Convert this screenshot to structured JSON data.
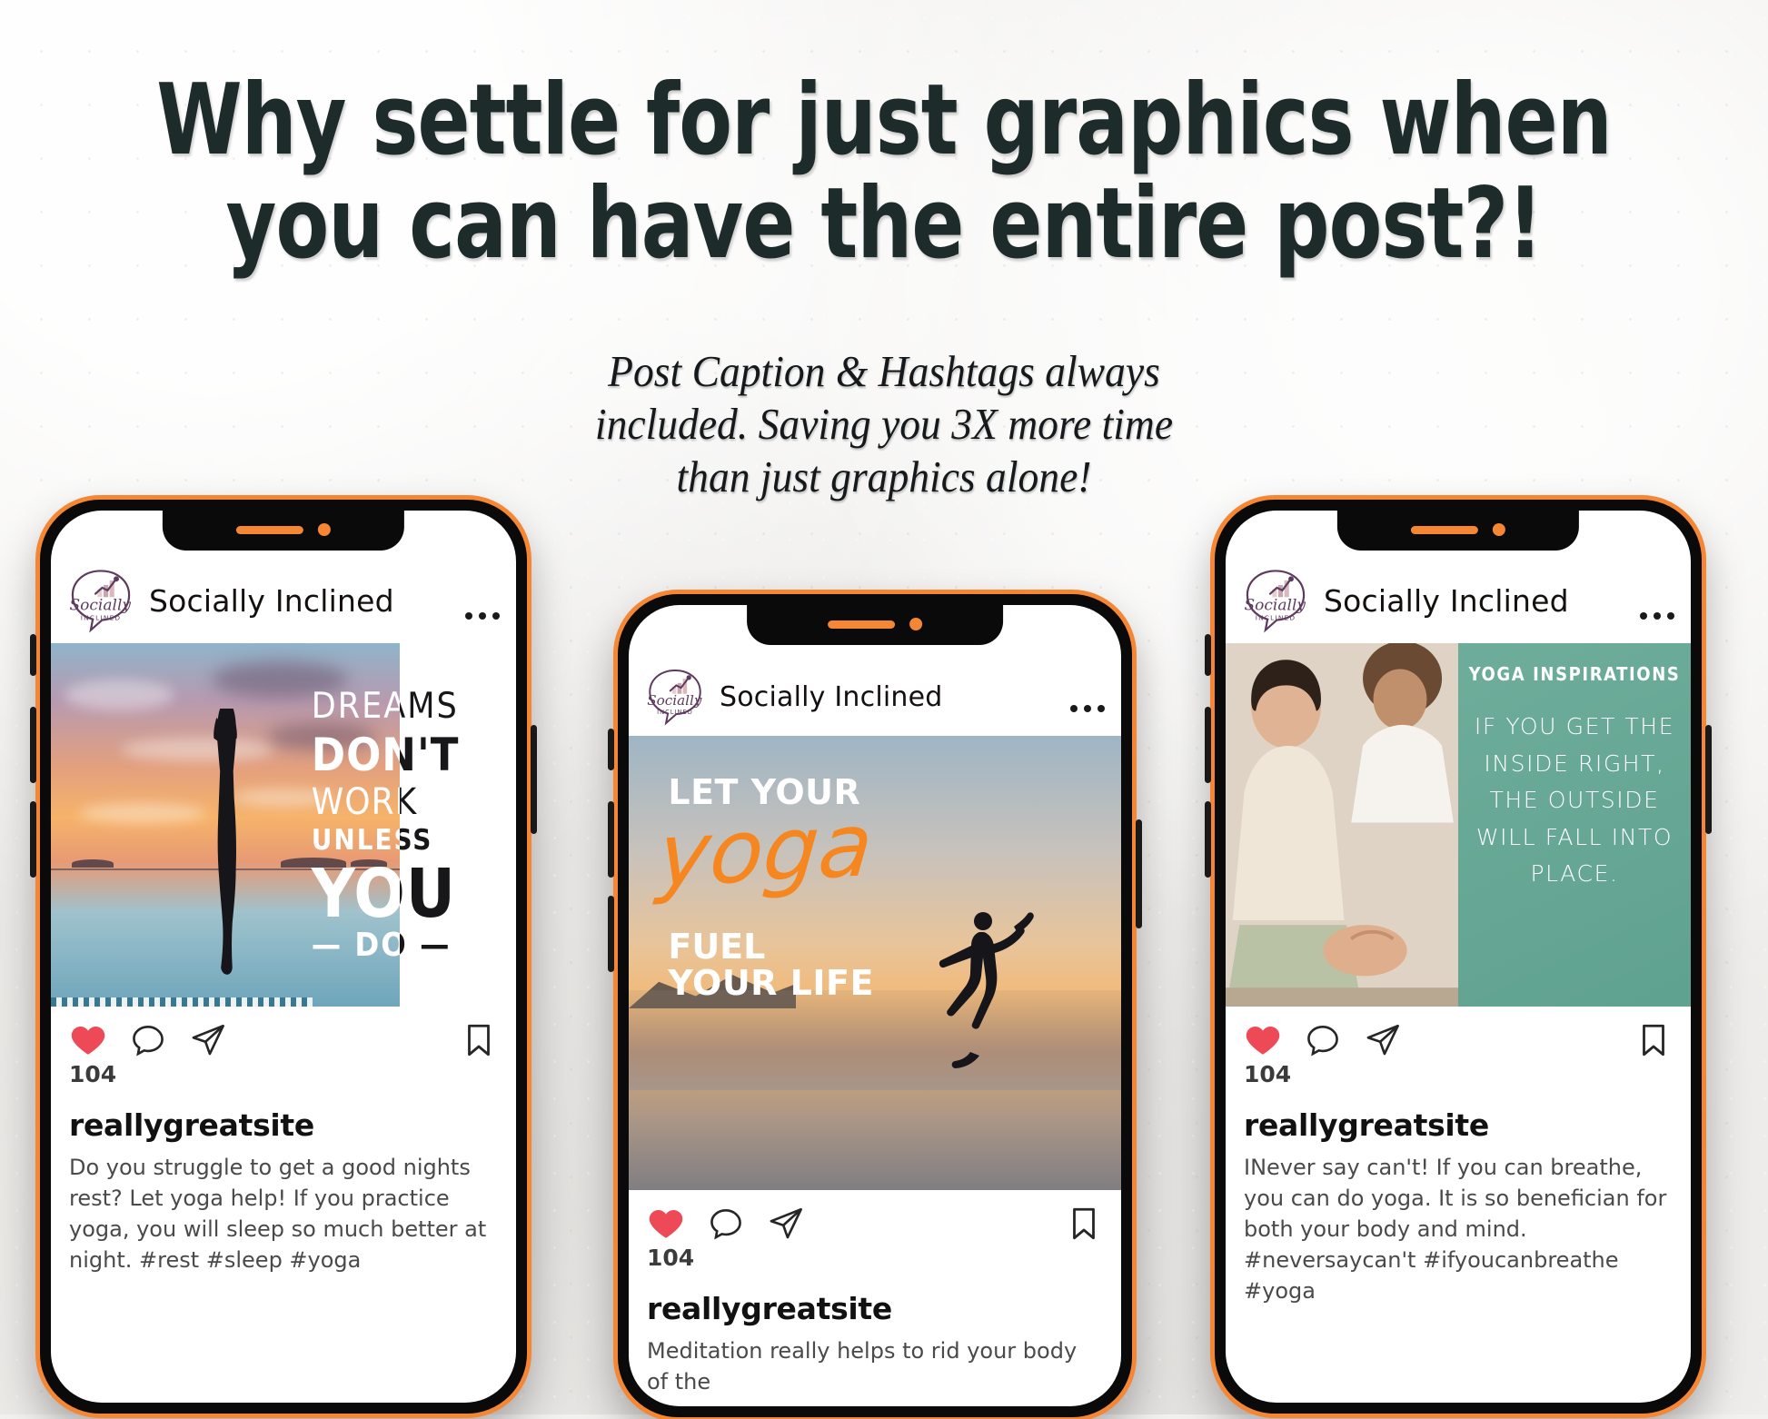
{
  "headline": {
    "line1": "Why settle for just graphics when",
    "line2": "you can have the entire post?!"
  },
  "subhead": {
    "line1": "Post Caption & Hashtags always",
    "line2": "included. Saving you 3X more time",
    "line3": "than just graphics alone!"
  },
  "colors": {
    "accent_orange": "#f58634",
    "headline_dark": "#1d2b2b",
    "logo_purple": "#5d3a5e",
    "heart_red": "#ed4956",
    "panel_green": "#58a08c",
    "background": "#f2f1ef"
  },
  "brand": {
    "name": "Socially Inclined",
    "logo_script": "Socially",
    "logo_sub": "INCLINED"
  },
  "icons": {
    "heart": "heart-icon",
    "comment": "comment-icon",
    "share": "share-icon",
    "bookmark": "bookmark-icon",
    "more": "more-options-icon"
  },
  "phones": [
    {
      "id": "phone-1",
      "post": {
        "handle": "reallygreatsite",
        "likes": "104",
        "caption": "Do you struggle to get a good nights rest? Let yoga help! If you practice yoga, you will sleep so much better at night. #rest #sleep #yoga",
        "artwork": {
          "type": "quote-over-sunset-photo",
          "lines": [
            "DREAMS",
            "DON'T",
            "WORK",
            "UNLESS",
            "YOU",
            "— DO —"
          ]
        }
      }
    },
    {
      "id": "phone-2",
      "post": {
        "handle": "reallygreatsite",
        "likes": "104",
        "caption": "Meditation really helps to rid your body of the",
        "artwork": {
          "type": "quote-over-beach-photo",
          "line1": "LET YOUR",
          "script": "yoga",
          "line2": "FUEL",
          "line3": "YOUR  LIFE"
        }
      }
    },
    {
      "id": "phone-3",
      "post": {
        "handle": "reallygreatsite",
        "likes": "104",
        "caption": "INever say can't! If you can breathe, you can do yoga. It is so benefician for both your body and mind. #neversaycan't #ifyoucanbreathe #yoga",
        "artwork": {
          "type": "split-photo-green-panel",
          "kicker": "YOGA INSPIRATIONS",
          "quote": "IF YOU GET THE INSIDE RIGHT, THE OUTSIDE WILL FALL INTO PLACE."
        }
      }
    }
  ]
}
